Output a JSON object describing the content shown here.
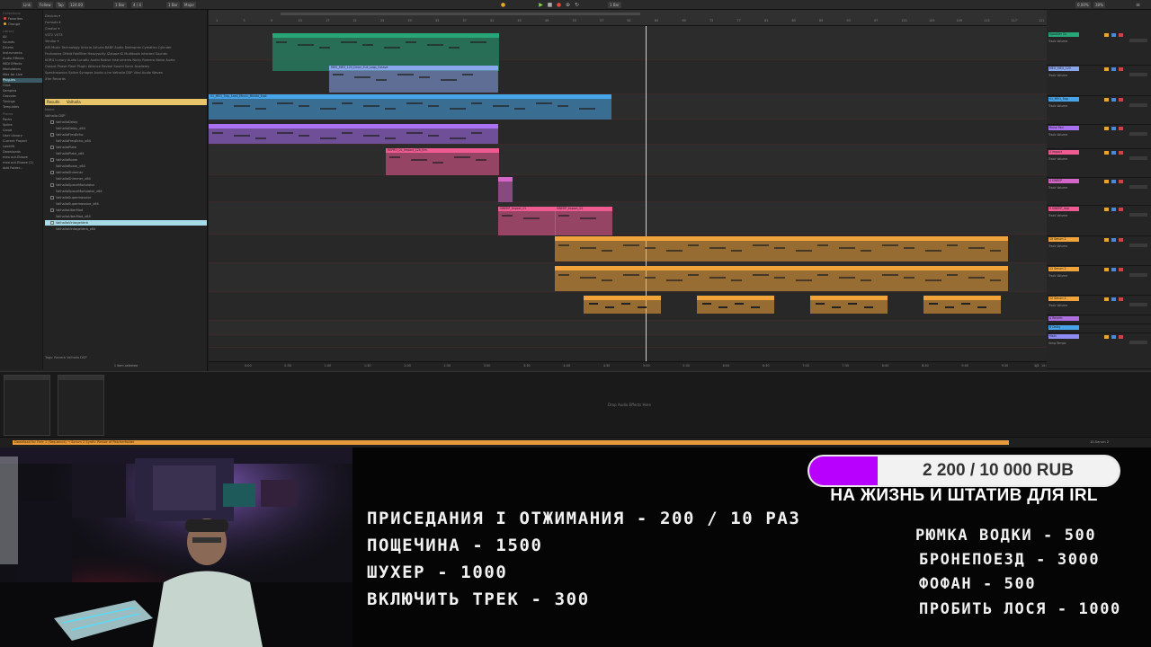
{
  "topbar": {
    "items": [
      "Link",
      "Follow",
      "Tap",
      "124.00",
      "1 Bar",
      "4 / 4",
      "1 Bar",
      "Major",
      "1 Bar",
      "0.00%",
      "38%"
    ]
  },
  "browser": {
    "places_header": "Collections",
    "collections": [
      "Favorites",
      "Orange"
    ],
    "categories_header": "Library",
    "categories": [
      "All",
      "Sounds",
      "Drums",
      "Instruments",
      "Audio Effects",
      "MIDI Effects",
      "Modulators",
      "Max for Live",
      "Plug-ins",
      "Clips",
      "Samples",
      "Grooves",
      "Tunings",
      "Templates"
    ],
    "places_header2": "Places",
    "places": [
      "Packs",
      "Splice",
      "Cloud",
      "User Library",
      "Current Project",
      "Lovelift",
      "Downloads",
      "meo out.Elosee",
      "meo out.Elosee (2)",
      "Add Folder..."
    ],
    "tags": [
      "Devices ▾",
      "Formats ▾",
      "Creator ▾",
      "VST2  VST3",
      "Vendor ▾",
      "AIR Music Technology   Arturia   Arturia   BABY Audio   Dolimpres   Cymatics   Cylinder",
      "Fruitzonez   Olfeld   FabFilter   Heavyocity   iZotope   KI Multitools   Infected Sounds",
      "KORG   Lunary Audio   Lunatic Audio   Native Instruments   Nicky Romero   Noise Audio",
      "Output   Phase Plant   Plugin Alliance   Reveal Sound   Sonic Academy",
      "Spectrasonics   Splice   Synapse Audio   u-he   Valhalla DSP   Vital Audio   Waves",
      "Xfer Records"
    ],
    "search_label": "Results",
    "search_value": "Valhalla",
    "name_header": "Name",
    "root_folder": "Valhalla DSP",
    "files": [
      "ValhallaDelay",
      "ValhallaDelay_x64",
      "ValhallaFreqEcho",
      "ValhallaFreqEcho_x64",
      "ValhallaPlate",
      "ValhallaPlate_x64",
      "ValhallaRoom",
      "ValhallaRoom_x64",
      "ValhallaShimmer",
      "ValhallaShimmer_x64",
      "ValhallaSpaceModulator",
      "ValhallaSpaceModulator_x64",
      "ValhallaSupermassive",
      "ValhallaSupermassive_x64",
      "ValhallaUberMod",
      "ValhallaUberMod_x64",
      "ValhallaVintageVerb",
      "ValhallaVintageVerb_x64"
    ],
    "selected_index": 16,
    "footer": "Tags:   Reverb   Valhalla DSP",
    "status": "1 item selected"
  },
  "arrangement": {
    "ruler_marks": [
      "1",
      "5",
      "9",
      "13",
      "17",
      "21",
      "25",
      "29",
      "33",
      "37",
      "41",
      "45",
      "49",
      "53",
      "57",
      "61",
      "65",
      "69",
      "73",
      "77",
      "81",
      "85",
      "89",
      "93",
      "97",
      "101",
      "105",
      "109",
      "113",
      "117",
      "121"
    ],
    "time_marks": [
      "0:00",
      "0:30",
      "1:00",
      "1:30",
      "2:00",
      "2:30",
      "3:00",
      "3:30",
      "4:00",
      "4:30",
      "5:00",
      "5:30",
      "6:00",
      "6:30",
      "7:00",
      "7:30",
      "8:00",
      "8:30",
      "9:00",
      "9:30",
      "10:00"
    ],
    "page_indicator": "1/2",
    "clips": [
      {
        "label": "",
        "color": "#27a67a"
      },
      {
        "label": "MEO_MEO_120_Drum_Full_Loop_Octave",
        "color": "#8aa7ee"
      },
      {
        "label": "01_MEO_Trap_Lead_Ethnic_Middle_East",
        "color": "#47a4e8"
      },
      {
        "label": "",
        "color": "#a970f2"
      },
      {
        "label": "REPRO_01_Impact_120_Bm",
        "color": "#ef5a91"
      },
      {
        "label": "",
        "color": "#d465c9"
      },
      {
        "label": "SWEEP_Impact_01",
        "color": "#ef5a91"
      },
      {
        "label": "SWEEP_Impact_02",
        "color": "#ef5a91"
      },
      {
        "label": "",
        "color": "#f0a43a"
      },
      {
        "label": "",
        "color": "#f0a43a"
      },
      {
        "label": "",
        "color": "#f0a43a"
      }
    ]
  },
  "mixer": {
    "tracks": [
      {
        "name": "Spookier Gu",
        "color": "#27a67a",
        "route": "Track Volume"
      },
      {
        "name": "MEO_MEO_120",
        "color": "#8aa7ee",
        "route": "Track Volume"
      },
      {
        "name": "01_MEO_Trap",
        "color": "#47a4e8",
        "route": "Track Volume"
      },
      {
        "name": "Rinse Pad",
        "color": "#a970f2",
        "route": "Track Volume"
      },
      {
        "name": "3 Impact",
        "color": "#ef5a91",
        "route": "Track Volume"
      },
      {
        "name": "4 SWEEP",
        "color": "#d465c9",
        "route": "Track Volume"
      },
      {
        "name": "5 SWEEP_Imp",
        "color": "#ef5a91",
        "route": "Track Volume"
      },
      {
        "name": "10 Serum 2",
        "color": "#f0a43a",
        "route": "Track Volume"
      },
      {
        "name": "11 Serum 2",
        "color": "#f0a43a",
        "route": "Track Volume"
      },
      {
        "name": "12 Serum 2",
        "color": "#f0a43a",
        "route": "Track Volume"
      },
      {
        "name": "A Reverb",
        "color": "#b06fe0",
        "route": "Send"
      },
      {
        "name": "B Delay",
        "color": "#47a4e8",
        "route": "Send"
      },
      {
        "name": "Main",
        "color": "#8c8cf2",
        "route": "Song Tempo"
      }
    ],
    "sends_label": "Sends",
    "master_value": "0"
  },
  "devices": {
    "drop_text": "Drop Audio Effects Here"
  },
  "statusbar": {
    "text": "Download for Free 1 (Sequence) → Serum 2 Synth: Resize of Patcherfolder",
    "right": "10-Serum 2"
  },
  "overlay": {
    "donation": {
      "text": "2 200 / 10 000 RUB",
      "current": 2200,
      "goal": 10000,
      "fill_color": "#b800ff"
    },
    "goal_text": "НА ЖИЗНЬ И ШТАТИВ ДЛЯ IRL",
    "left_menu": [
      "ПРИСЕДАНИЯ I ОТЖИМАНИЯ - 200 / 10 РАЗ",
      "ПОЩЕЧИНА - 1500",
      "ШУХЕР - 1000",
      "ВКЛЮЧИТЬ ТРЕК - 300"
    ],
    "right_menu": [
      "РЮМКА ВОДКИ - 500",
      "БРОНЕПОЕЗД - 3000",
      "ФОФАН - 500",
      "ПРОБИТЬ ЛОСЯ - 1000"
    ]
  }
}
